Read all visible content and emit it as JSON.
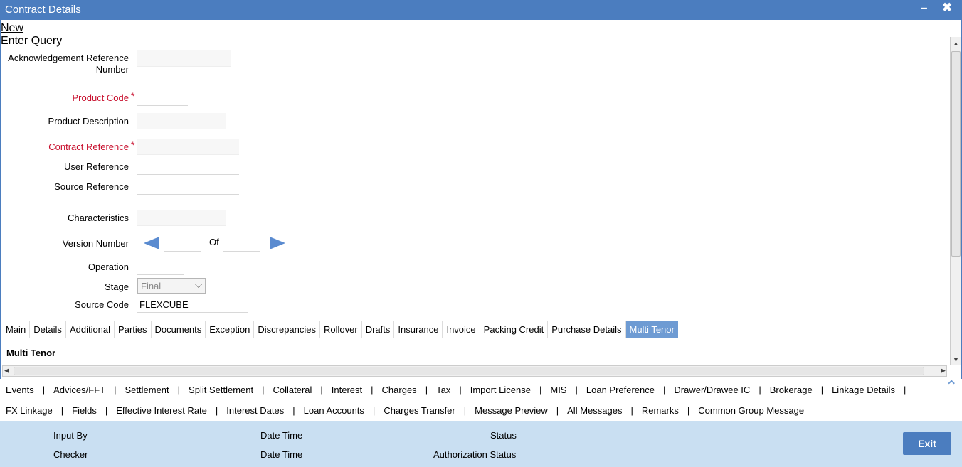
{
  "window": {
    "title": "Contract Details",
    "minimize": "–",
    "close": "✖"
  },
  "links": {
    "new": "New",
    "enter_query": "Enter Query"
  },
  "form": {
    "ack_ref_line1": "Acknowledgement Reference",
    "ack_ref_line2": "Number",
    "product_code": "Product Code",
    "product_description": "Product Description",
    "contract_reference": "Contract Reference",
    "user_reference": "User Reference",
    "source_reference": "Source Reference",
    "characteristics": "Characteristics",
    "version_number": "Version Number",
    "of": "Of",
    "operation": "Operation",
    "stage": "Stage",
    "stage_value": "Final",
    "source_code": "Source Code",
    "source_code_value": "FLEXCUBE",
    "required_mark": "*"
  },
  "tabs": [
    "Main",
    "Details",
    "Additional",
    "Parties",
    "Documents",
    "Exception",
    "Discrepancies",
    "Rollover",
    "Drafts",
    "Insurance",
    "Invoice",
    "Packing Credit",
    "Purchase Details",
    "Multi Tenor"
  ],
  "active_tab": "Multi Tenor",
  "section": {
    "title": "Multi Tenor"
  },
  "toolbar": {
    "row1": [
      "Events",
      "Advices/FFT",
      "Settlement",
      "Split Settlement",
      "Collateral",
      "Interest",
      "Charges",
      "Tax",
      "Import License",
      "MIS",
      "Loan Preference",
      "Drawer/Drawee IC",
      "Brokerage",
      "Linkage Details"
    ],
    "row2": [
      "FX Linkage",
      "Fields",
      "Effective Interest Rate",
      "Interest Dates",
      "Loan Accounts",
      "Charges Transfer",
      "Message Preview",
      "All Messages",
      "Remarks",
      "Common Group Message"
    ],
    "separator": "|"
  },
  "footer": {
    "input_by": "Input By",
    "date_time_1": "Date Time",
    "status": "Status",
    "checker": "Checker",
    "date_time_2": "Date Time",
    "authorization_status": "Authorization Status",
    "exit": "Exit"
  },
  "colors": {
    "accent": "#4b7dbf",
    "required": "#c8102e",
    "footer": "#c9dff2",
    "active_tab": "#6e9bd3"
  }
}
